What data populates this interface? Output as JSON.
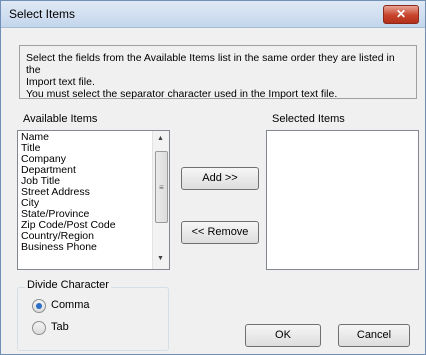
{
  "window": {
    "title": "Select Items",
    "close_label": "✕"
  },
  "info": {
    "line1": "Select the fields from the Available Items list in the same order they are listed in the",
    "line2": "Import text file.",
    "line3": "You must select the separator character used in the Import text file."
  },
  "available": {
    "label": "Available Items",
    "items": [
      "Name",
      "Title",
      "Company",
      "Department",
      "Job Title",
      "Street Address",
      "City",
      "State/Province",
      "Zip Code/Post Code",
      "Country/Region",
      "Business Phone"
    ]
  },
  "selected": {
    "label": "Selected Items",
    "items": []
  },
  "buttons": {
    "add": "Add >>",
    "remove": "<< Remove",
    "ok": "OK",
    "cancel": "Cancel"
  },
  "divide": {
    "title": "Divide Character",
    "options": [
      {
        "label": "Comma",
        "checked": true
      },
      {
        "label": "Tab",
        "checked": false
      }
    ]
  },
  "icons": {
    "scroll_up": "▲",
    "scroll_down": "▼",
    "grip": "≡"
  }
}
